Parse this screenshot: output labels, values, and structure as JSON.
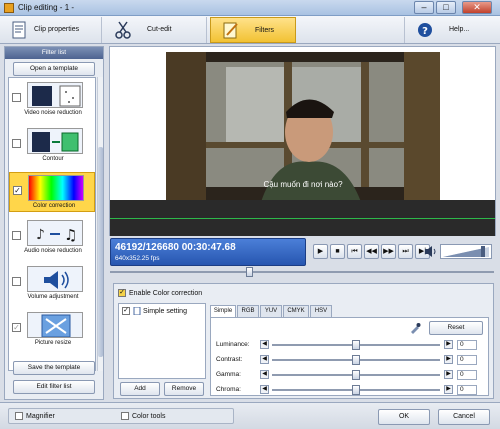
{
  "window": {
    "title": "Clip editing - 1 -"
  },
  "toolbar": {
    "tabs": [
      {
        "label": "Clip properties",
        "icon": "clip-properties-icon"
      },
      {
        "label": "Cut-edit",
        "icon": "scissors-icon"
      },
      {
        "label": "Filters",
        "icon": "filters-icon",
        "active": true
      },
      {
        "label": "Help...",
        "icon": "help-icon"
      }
    ]
  },
  "filter_panel": {
    "header": "Filter list",
    "open_template": "Open a template",
    "items": [
      {
        "label": "Video noise reduction",
        "checked": false
      },
      {
        "label": "Contour",
        "checked": false
      },
      {
        "label": "Color correction",
        "checked": true,
        "selected": true
      },
      {
        "label": "Audio noise reduction",
        "checked": false
      },
      {
        "label": "Volume adjustment",
        "checked": false
      },
      {
        "label": "Picture resize",
        "checked": true
      }
    ],
    "save_template": "Save the template",
    "edit_filter_list": "Edit filter list"
  },
  "video": {
    "subtitle": "Cậu muốn đi nơi nào?"
  },
  "player": {
    "time": "46192/126680  00:30:47.68",
    "info": "640x352.25  fps",
    "volume_level": 0.85
  },
  "settings": {
    "enable_label": "Enable Color correction",
    "enable_checked": true,
    "list_items": [
      {
        "label": "Simple setting",
        "checked": true
      }
    ],
    "add": "Add",
    "remove": "Remove",
    "tabs": [
      "Simple",
      "RGB",
      "YUV",
      "CMYK",
      "HSV"
    ],
    "active_tab": "Simple",
    "reset": "Reset",
    "rows": [
      {
        "label": "Luminance:",
        "value": "0",
        "level": 0.5
      },
      {
        "label": "Contrast:",
        "value": "0",
        "level": 0.5
      },
      {
        "label": "Gamma:",
        "value": "0",
        "level": 0.5
      },
      {
        "label": "Chroma:",
        "value": "0",
        "level": 0.5
      }
    ]
  },
  "statusbar": {
    "magnifier": "Magnifier",
    "color_tools": "Color tools",
    "ok": "OK",
    "cancel": "Cancel"
  },
  "colors": {
    "accent": "#f2c233",
    "time_bg": "#2756b0",
    "selection": "#ffd64a"
  }
}
